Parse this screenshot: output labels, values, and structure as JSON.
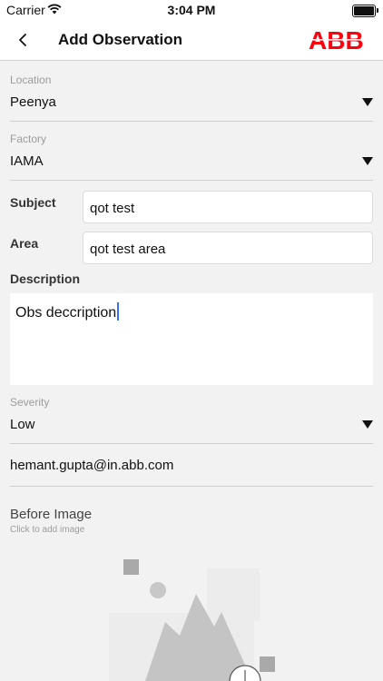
{
  "status_bar": {
    "carrier": "Carrier",
    "time": "3:04 PM"
  },
  "nav": {
    "title": "Add Observation",
    "brand": "ABB",
    "brand_color": "#ff000f"
  },
  "location": {
    "label": "Location",
    "value": "Peenya"
  },
  "factory": {
    "label": "Factory",
    "value": "IAMA"
  },
  "subject": {
    "label": "Subject",
    "value": "qot test"
  },
  "area": {
    "label": "Area",
    "value": "qot test area"
  },
  "description": {
    "label": "Description",
    "value": "Obs deccription"
  },
  "severity": {
    "label": "Severity",
    "value": "Low"
  },
  "email": "hemant.gupta@in.abb.com",
  "before_image": {
    "title": "Before Image",
    "hint": "Click to add image"
  }
}
